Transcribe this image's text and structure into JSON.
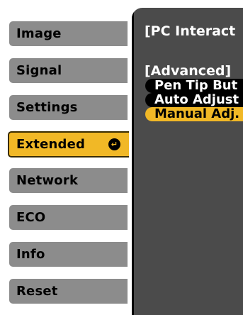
{
  "sidebar": {
    "items": [
      {
        "label": "Image"
      },
      {
        "label": "Signal"
      },
      {
        "label": "Settings"
      },
      {
        "label": "Extended"
      },
      {
        "label": "Network"
      },
      {
        "label": "ECO"
      },
      {
        "label": "Info"
      },
      {
        "label": "Reset"
      }
    ],
    "active_index": 3,
    "enter_glyph": "↵"
  },
  "panel": {
    "title": "[PC Interact",
    "section": "[Advanced]",
    "options": [
      {
        "label": "Pen Tip But"
      },
      {
        "label": "Auto Adjust"
      },
      {
        "label": "Manual Adj."
      }
    ],
    "selected_index": 2
  },
  "colors": {
    "menu_bg": "#8c8c8c",
    "accent": "#f1b826",
    "panel_bg": "#4b4b4b"
  }
}
